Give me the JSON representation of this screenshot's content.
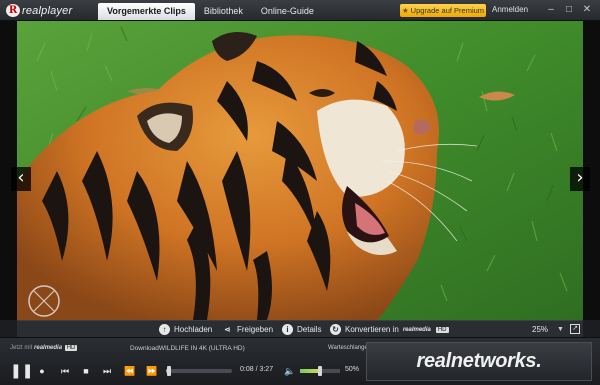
{
  "app": {
    "logo_text": "realplayer",
    "logo_mark": "R"
  },
  "tabs": [
    {
      "label": "Vorgemerkte Clips",
      "active": true
    },
    {
      "label": "Bibliothek",
      "active": false
    },
    {
      "label": "Online-Guide",
      "active": false
    }
  ],
  "header": {
    "upgrade_label": "Upgrade auf Premium",
    "signin_label": "Anmelden"
  },
  "window_controls": {
    "minimize": "–",
    "maximize": "□",
    "close": "✕"
  },
  "player": {
    "prev_icon": "chevron-left-icon",
    "next_icon": "chevron-right-icon"
  },
  "actions": {
    "upload_label": "Hochladen",
    "share_label": "Freigeben",
    "details_label": "Details",
    "convert_label": "Konvertieren in",
    "convert_brand": "realmedia",
    "convert_badge": "HD",
    "zoom": "25%"
  },
  "info": {
    "now_with": "Jetzt mit",
    "now_with_brand": "realmedia",
    "now_with_badge": "HD",
    "now_playing": "DownloadWILDLIFE IN 4K (ULTRA HD)",
    "queue_label": "Warteschlange",
    "time": "0:08 / 3:27",
    "progress_fraction": 0.04,
    "volume_label": "50%",
    "volume_fraction": 0.5,
    "brand": "realnetworks."
  },
  "colors": {
    "accent": "#f0a800",
    "background": "#1b1d20",
    "grass": "#4c8f30"
  }
}
